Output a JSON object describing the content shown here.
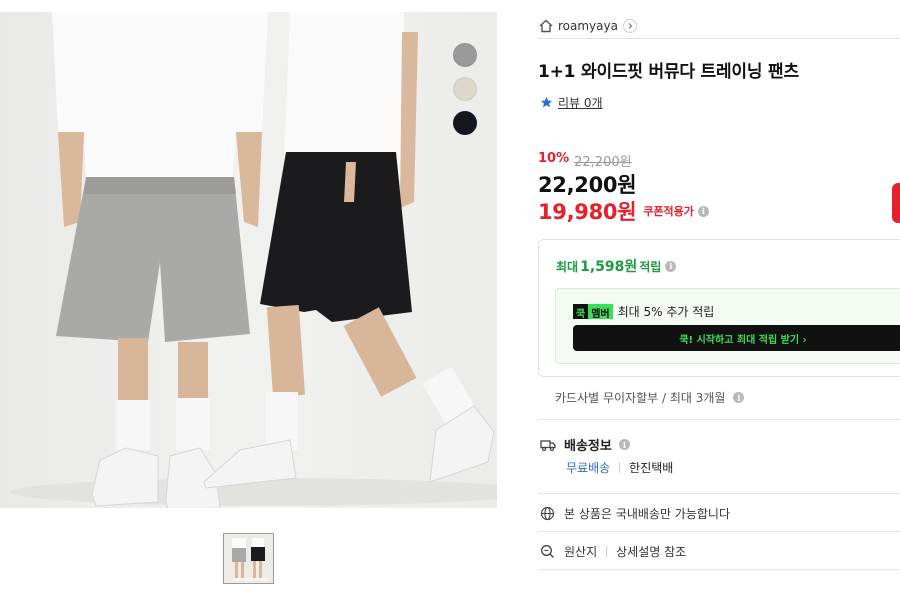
{
  "gallery": {
    "swatches": [
      {
        "name": "gray",
        "color": "#9a9a9a"
      },
      {
        "name": "beige",
        "color": "#ddd8cc"
      },
      {
        "name": "black",
        "color": "#141620"
      }
    ]
  },
  "store": {
    "name": "roamyaya"
  },
  "product": {
    "title": "1+1 와이드핏 버뮤다 트레이닝 팬츠",
    "review_text": "리뷰 0개",
    "discount": "10%",
    "original_price": "22,200원",
    "price": "22,200원",
    "coupon_price": "19,980원",
    "coupon_label": "쿠폰적용가"
  },
  "points": {
    "prefix": "최대",
    "amount": "1,598원",
    "suffix": "적립",
    "badge_a": "쿡",
    "badge_b": "멤버",
    "member_text": "최대 5% 추가 적립",
    "member_cta": "쿡! 시작하고 최대 적립 받기  ›"
  },
  "installment": "카드사별 무이자할부 / 최대 3개월",
  "shipping": {
    "label": "배송정보",
    "free": "무료배송",
    "carrier": "한진택배"
  },
  "domestic": "본 상품은 국내배송만 가능합니다",
  "origin": {
    "label": "원산지",
    "value": "상세설명 참조"
  },
  "colors": {
    "red": "#e5222b",
    "green": "#1d9c3f",
    "neon": "#3ddc5a",
    "blue": "#2a6fcf"
  }
}
